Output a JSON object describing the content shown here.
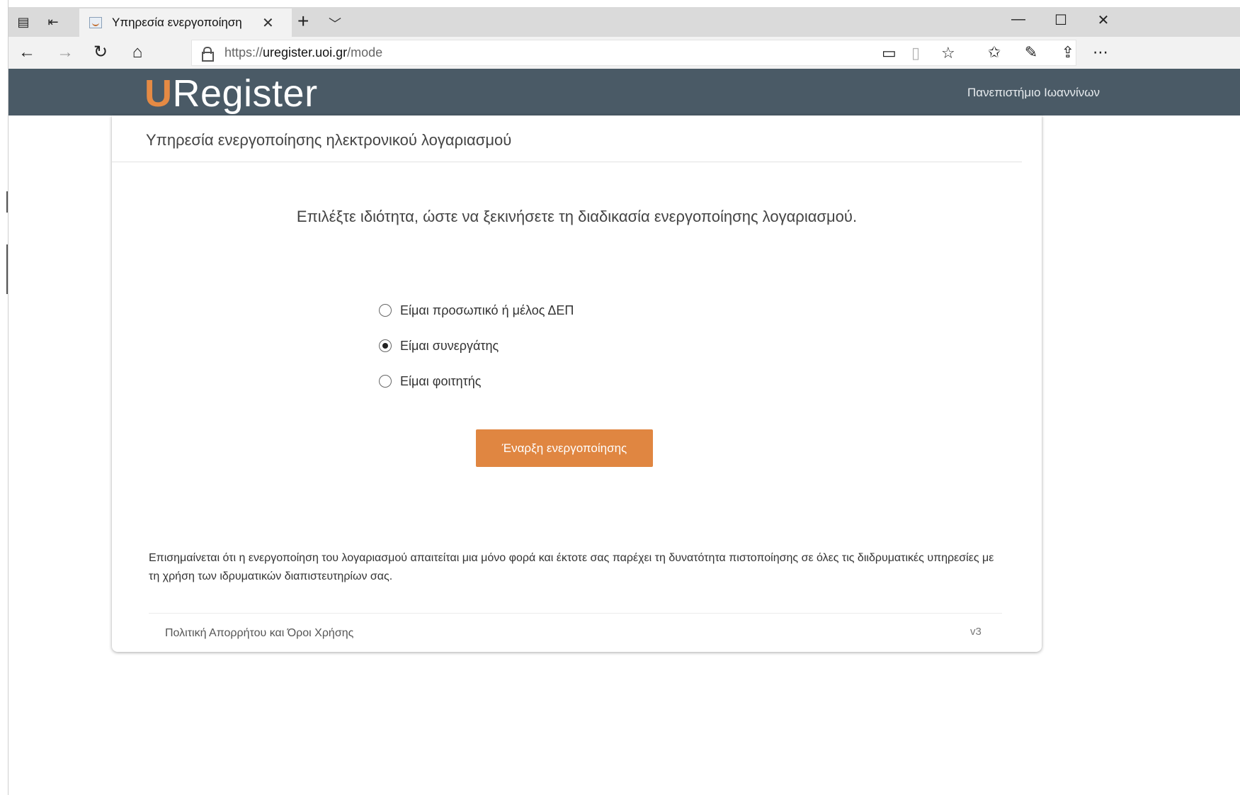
{
  "browser": {
    "tab_title": "Υπηρεσία ενεργοποίηση",
    "url_prefix": "https://",
    "url_host": "uregister.uoi.gr",
    "url_path": "/mode",
    "icons": {
      "tab_sets": "tabs-aside-icon",
      "set_aside": "set-aside-icon",
      "favicon": "site-favicon-icon",
      "close_tab": "close-icon",
      "new_tab": "plus-icon",
      "tab_menu": "chevron-down-icon",
      "minimize": "minimize-icon",
      "maximize": "maximize-icon",
      "close_window": "close-icon",
      "back": "back-arrow-icon",
      "forward": "forward-arrow-icon",
      "refresh": "refresh-icon",
      "home": "home-icon",
      "lock": "lock-icon",
      "reading_view": "reading-view-icon",
      "book": "book-icon",
      "favorite": "star-icon",
      "favorites_hub": "favorites-list-icon",
      "notes": "pen-icon",
      "share": "share-icon",
      "more": "more-icon"
    }
  },
  "header": {
    "logo_u": "U",
    "logo_rest": "Register",
    "institution": "Πανεπιστήμιο Ιωαννίνων"
  },
  "card": {
    "title": "Υπηρεσία ενεργοποίησης ηλεκτρονικού λογαριασμού",
    "instruction": "Επιλέξτε ιδιότητα, ώστε να ξεκινήσετε τη διαδικασία ενεργοποίησης λογαριασμού.",
    "options": [
      {
        "label": "Είμαι προσωπικό ή μέλος ΔΕΠ",
        "checked": false
      },
      {
        "label": "Είμαι συνεργάτης",
        "checked": true
      },
      {
        "label": "Είμαι φοιτητής",
        "checked": false
      }
    ],
    "start_button": "Έναρξη ενεργοποίησης",
    "note": "Επισημαίνεται ότι η ενεργοποίηση του λογαριασμού απαιτείται μια μόνο φορά και έκτοτε σας παρέχει τη δυνατότητα πιστοποίησης σε όλες τις διιδρυματικές υπηρεσίες με τη χρήση των ιδρυματικών διαπιστευτηρίων σας.",
    "policy_link": "Πολιτική Απορρήτου και Όροι Χρήσης",
    "version": "v3"
  },
  "colors": {
    "header_bg": "#4a5a66",
    "accent": "#e08641",
    "logo_u": "#e58a44"
  }
}
